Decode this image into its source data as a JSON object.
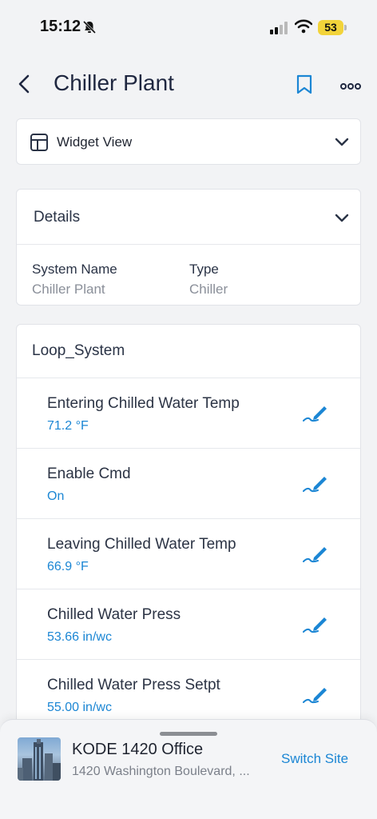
{
  "status_bar": {
    "time": "15:12",
    "battery": "53"
  },
  "header": {
    "title": "Chiller Plant"
  },
  "widget_selector": {
    "label": "Widget View"
  },
  "details": {
    "title": "Details",
    "fields": [
      {
        "label": "System Name",
        "value": "Chiller Plant"
      },
      {
        "label": "Type",
        "value": "Chiller"
      }
    ]
  },
  "loop_system": {
    "title": "Loop_System",
    "points": [
      {
        "name": "Entering Chilled Water Temp",
        "value": "71.2 °F"
      },
      {
        "name": "Enable Cmd",
        "value": "On"
      },
      {
        "name": "Leaving Chilled Water Temp",
        "value": "66.9 °F"
      },
      {
        "name": "Chilled Water Press",
        "value": "53.66 in/wc"
      },
      {
        "name": "Chilled Water Press Setpt",
        "value": "55.00 in/wc"
      }
    ]
  },
  "site": {
    "name": "KODE 1420 Office",
    "address": "1420 Washington Boulevard, ...",
    "switch_label": "Switch Site"
  },
  "icons": {
    "back": "chevron-left-icon",
    "bookmark": "bookmark-icon",
    "more": "more-horizontal-icon",
    "widget": "layout-icon",
    "edit": "edit-pen-icon"
  },
  "colors": {
    "accent": "#1b86d4",
    "battery": "#f2d33a"
  }
}
